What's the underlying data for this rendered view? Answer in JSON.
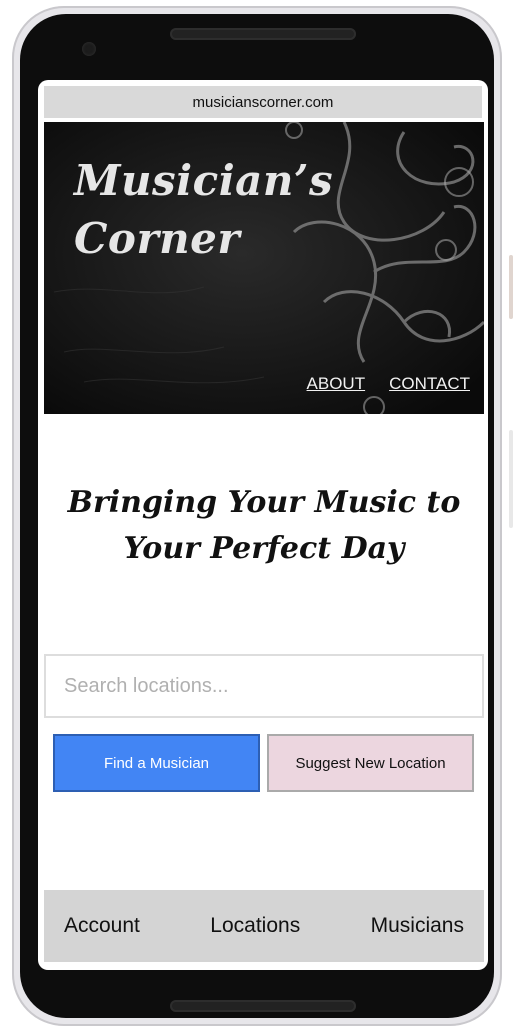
{
  "browser": {
    "url": "musicianscorner.com"
  },
  "hero": {
    "logo_line1": "Musician’s",
    "logo_line2": "Corner",
    "nav": {
      "about": "ABOUT",
      "contact": "CONTACT"
    }
  },
  "main": {
    "tagline_line1": "Bringing Your Music to",
    "tagline_line2": "Your Perfect Day",
    "search_placeholder": "Search locations...",
    "find_button": "Find a Musician",
    "suggest_button": "Suggest New Location"
  },
  "bottom_nav": {
    "items": [
      "Account",
      "Locations",
      "Musicians"
    ]
  },
  "colors": {
    "primary_button": "#4285f4",
    "secondary_button": "#ecd6df",
    "hero_bg": "#111111",
    "bottom_nav_bg": "#d4d4d4"
  }
}
